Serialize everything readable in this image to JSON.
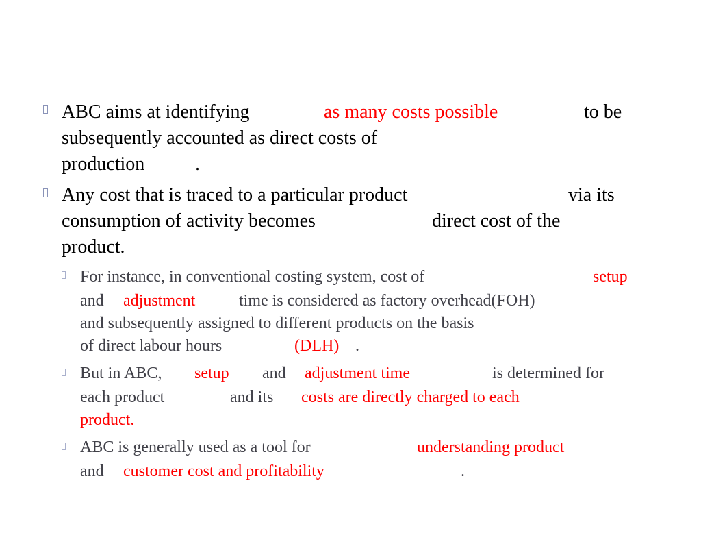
{
  "bullets": [
    {
      "level": 1,
      "lines": [
        [
          {
            "t": "ABC aims at identifying",
            "c": "normal"
          },
          {
            "t": "as many costs possible",
            "c": "red"
          },
          {
            "t": "to be",
            "c": "normal"
          }
        ],
        [
          {
            "t": "subsequently accounted as direct costs of",
            "c": "normal"
          }
        ],
        [
          {
            "t": "production",
            "c": "normal"
          },
          {
            "t": ".",
            "c": "normal"
          }
        ]
      ]
    },
    {
      "level": 1,
      "lines": [
        [
          {
            "t": "Any cost that is traced to a particular product",
            "c": "normal"
          },
          {
            "t": "via its",
            "c": "normal"
          }
        ],
        [
          {
            "t": "consumption of activity becomes",
            "c": "normal"
          },
          {
            "t": "direct cost of the",
            "c": "normal"
          }
        ],
        [
          {
            "t": "product.",
            "c": "normal"
          }
        ]
      ]
    },
    {
      "level": 2,
      "lines": [
        [
          {
            "t": "For instance, in conventional costing system, cost of",
            "c": "normal"
          },
          {
            "t": "setup",
            "c": "red"
          }
        ],
        [
          {
            "t": "and",
            "c": "normal"
          },
          {
            "t": "adjustment",
            "c": "red"
          },
          {
            "t": "time is considered as factory overhead(FOH)",
            "c": "normal"
          }
        ],
        [
          {
            "t": "and subsequently assigned to different products on the basis",
            "c": "normal"
          }
        ],
        [
          {
            "t": "of direct labour hours",
            "c": "normal"
          },
          {
            "t": "(DLH)",
            "c": "red"
          },
          {
            "t": ".",
            "c": "normal"
          }
        ]
      ]
    },
    {
      "level": 2,
      "lines": [
        [
          {
            "t": "But in ABC,",
            "c": "normal"
          },
          {
            "t": "setup",
            "c": "red"
          },
          {
            "t": "and",
            "c": "normal"
          },
          {
            "t": "adjustment time",
            "c": "red"
          },
          {
            "t": "is determined for",
            "c": "normal"
          }
        ],
        [
          {
            "t": "each product",
            "c": "normal"
          },
          {
            "t": "and its",
            "c": "normal"
          },
          {
            "t": "costs are directly charged to each",
            "c": "red"
          }
        ],
        [
          {
            "t": "product.",
            "c": "red"
          }
        ]
      ]
    },
    {
      "level": 2,
      "lines": [
        [
          {
            "t": "ABC is generally used as a tool for",
            "c": "normal"
          },
          {
            "t": "understanding product",
            "c": "red"
          }
        ],
        [
          {
            "t": "and",
            "c": "normal"
          },
          {
            "t": "customer cost and profitability",
            "c": "red"
          },
          {
            "t": ".",
            "c": "normal"
          }
        ]
      ]
    }
  ],
  "colors": {
    "highlight": "#ff0000",
    "body_text": "#000000",
    "sub_text": "#404048",
    "bullet": "#8a93b8"
  }
}
